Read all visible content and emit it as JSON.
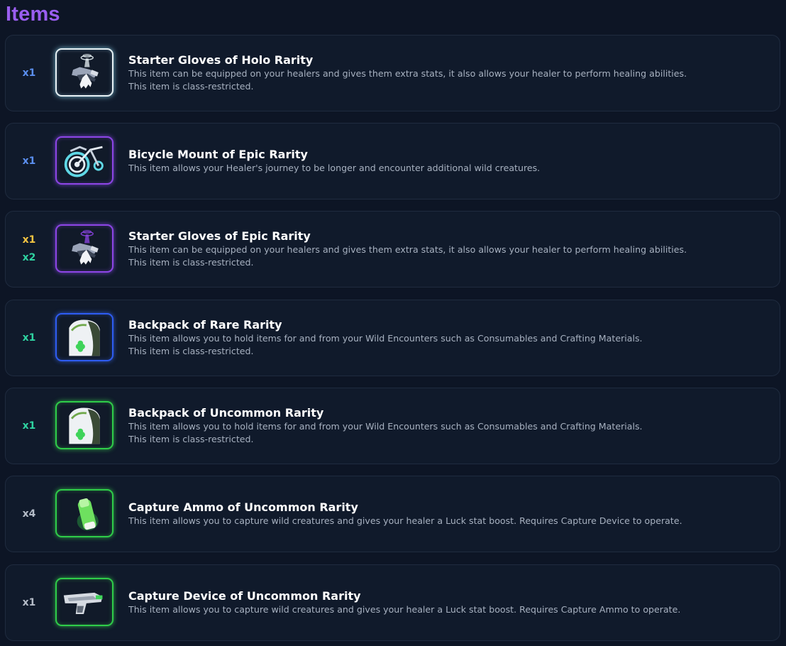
{
  "page": {
    "title": "Items"
  },
  "colors": {
    "title": "#9a5ef0",
    "background": "#0d1525",
    "card": "#101a2b",
    "qty_blue": "#5b8ff0",
    "qty_gold": "#f5c542",
    "qty_teal": "#2fd3a1",
    "qty_gray": "#b5bcc8",
    "holo": "#e8f2f5",
    "epic": "#8d45e6",
    "rare": "#2e5cf2",
    "uncommon": "#2fcd49"
  },
  "items": [
    {
      "quantities": [
        {
          "text": "x1"
        }
      ],
      "rarity": "holo",
      "icon": "gloves-icon",
      "name": "Starter Gloves of Holo Rarity",
      "desc1": "This item can be equipped on your healers and gives them extra stats, it also allows your healer to perform healing abilities.",
      "desc2": "This item is class-restricted."
    },
    {
      "quantities": [
        {
          "text": "x1"
        }
      ],
      "rarity": "epic",
      "icon": "bicycle-icon",
      "name": "Bicycle Mount of Epic Rarity",
      "desc1": "This item allows your Healer's journey to be longer and encounter additional wild creatures.",
      "desc2": ""
    },
    {
      "quantities": [
        {
          "text": "x1"
        },
        {
          "text": "x2"
        }
      ],
      "rarity": "epic",
      "icon": "gloves-icon",
      "name": "Starter Gloves of Epic Rarity",
      "desc1": "This item can be equipped on your healers and gives them extra stats, it also allows your healer to perform healing abilities.",
      "desc2": "This item is class-restricted."
    },
    {
      "quantities": [
        {
          "text": "x1"
        }
      ],
      "rarity": "rare",
      "icon": "backpack-icon",
      "name": "Backpack of Rare Rarity",
      "desc1": "This item allows you to hold items for and from your Wild Encounters such as Consumables and Crafting Materials.",
      "desc2": "This item is class-restricted."
    },
    {
      "quantities": [
        {
          "text": "x1"
        }
      ],
      "rarity": "uncommon",
      "icon": "backpack-icon",
      "name": "Backpack of Uncommon Rarity",
      "desc1": "This item allows you to hold items for and from your Wild Encounters such as Consumables and Crafting Materials.",
      "desc2": "This item is class-restricted."
    },
    {
      "quantities": [
        {
          "text": "x4"
        }
      ],
      "rarity": "uncommon",
      "icon": "ammo-icon",
      "name": "Capture Ammo of Uncommon Rarity",
      "desc1": "This item allows you to capture wild creatures and gives your healer a Luck stat boost. Requires Capture Device to operate.",
      "desc2": ""
    },
    {
      "quantities": [
        {
          "text": "x1"
        }
      ],
      "rarity": "uncommon",
      "icon": "capture-device-icon",
      "name": "Capture Device of Uncommon Rarity",
      "desc1": "This item allows you to capture wild creatures and gives your healer a Luck stat boost. Requires Capture Ammo to operate.",
      "desc2": ""
    }
  ]
}
